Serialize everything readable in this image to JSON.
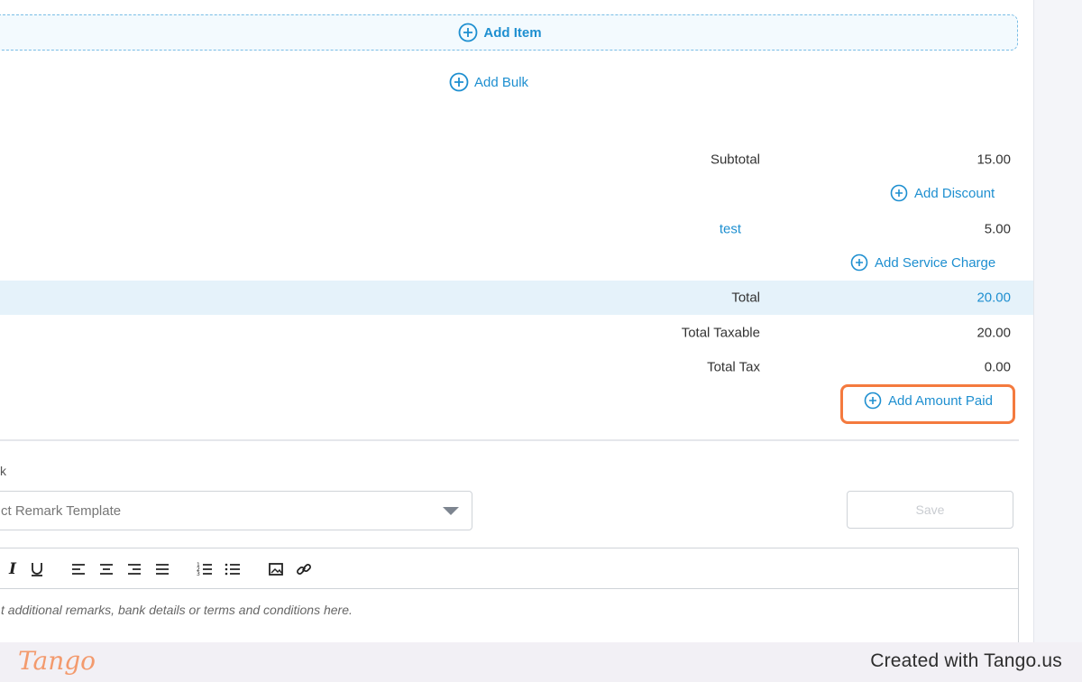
{
  "actions": {
    "add_item": "Add Item",
    "add_bulk": "Add Bulk"
  },
  "summary": {
    "subtotal_label": "Subtotal",
    "subtotal_value": "15.00",
    "add_discount": "Add Discount",
    "service_charge_label": "test",
    "service_charge_value": "5.00",
    "add_service_charge": "Add Service Charge",
    "total_label": "Total",
    "total_value": "20.00",
    "total_taxable_label": "Total Taxable",
    "total_taxable_value": "20.00",
    "total_tax_label": "Total Tax",
    "total_tax_value": "0.00",
    "add_amount_paid": "Add Amount Paid"
  },
  "remark": {
    "label": "k",
    "template_placeholder": "ct Remark Template",
    "save_label": "Save",
    "editor_placeholder": "t additional remarks, bank details or terms and conditions here.",
    "toolbar_icons": [
      "italic-icon",
      "underline-icon",
      "align-left-icon",
      "align-center-icon",
      "align-right-icon",
      "align-justify-icon",
      "ordered-list-icon",
      "bullet-list-icon",
      "image-icon",
      "link-icon"
    ]
  },
  "footer": {
    "logo": "Tango",
    "created_with": "Created with Tango.us"
  },
  "colors": {
    "accent": "#1e8fd0",
    "highlight": "#f47a3e",
    "total_row_bg": "#e5f2fa"
  }
}
